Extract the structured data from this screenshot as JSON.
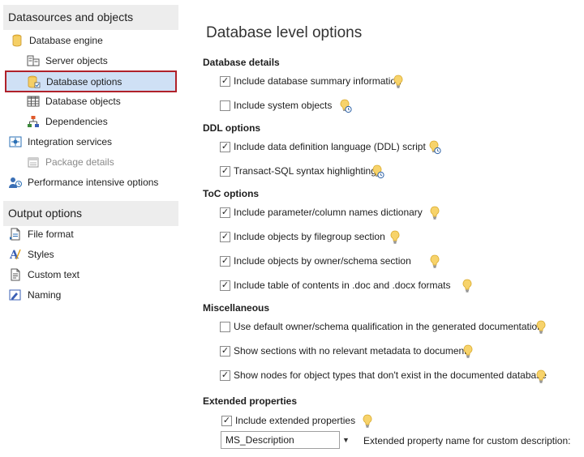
{
  "sidebar": {
    "header1": "Datasources and objects",
    "header2": "Output options",
    "items": [
      {
        "label": "Database engine"
      },
      {
        "label": "Server objects"
      },
      {
        "label": "Database options"
      },
      {
        "label": "Database objects"
      },
      {
        "label": "Dependencies"
      },
      {
        "label": "Integration services"
      },
      {
        "label": "Package details"
      },
      {
        "label": "Performance intensive options"
      },
      {
        "label": "File format"
      },
      {
        "label": "Styles"
      },
      {
        "label": "Custom text"
      },
      {
        "label": "Naming"
      }
    ]
  },
  "main": {
    "title": "Database level options",
    "sections": [
      {
        "title": "Database details"
      },
      {
        "title": "DDL options"
      },
      {
        "title": "ToC options"
      },
      {
        "title": "Miscellaneous"
      },
      {
        "title": "Extended properties"
      }
    ],
    "options": [
      {
        "label": "Include database summary information",
        "checked": true
      },
      {
        "label": "Include system objects",
        "checked": false
      },
      {
        "label": "Include data definition language (DDL) script",
        "checked": true
      },
      {
        "label": "Transact-SQL syntax highlighting",
        "checked": true
      },
      {
        "label": "Include parameter/column names dictionary",
        "checked": true
      },
      {
        "label": "Include objects by filegroup section",
        "checked": true
      },
      {
        "label": "Include objects by owner/schema section",
        "checked": true
      },
      {
        "label": "Include table of contents in .doc and .docx formats",
        "checked": true
      },
      {
        "label": "Use default owner/schema qualification in the generated documentation",
        "checked": false
      },
      {
        "label": "Show sections with no relevant metadata to document",
        "checked": true
      },
      {
        "label": "Show nodes for object types that don't exist in the documented database",
        "checked": true
      },
      {
        "label": "Include extended properties",
        "checked": true
      }
    ],
    "extended": {
      "select_value": "MS_Description",
      "label": "Extended property name for custom description:"
    },
    "check_glyph": "✓",
    "icons": {
      "hint": "lightbulb-icon",
      "slow": "lightbulb-clock-icon"
    }
  }
}
